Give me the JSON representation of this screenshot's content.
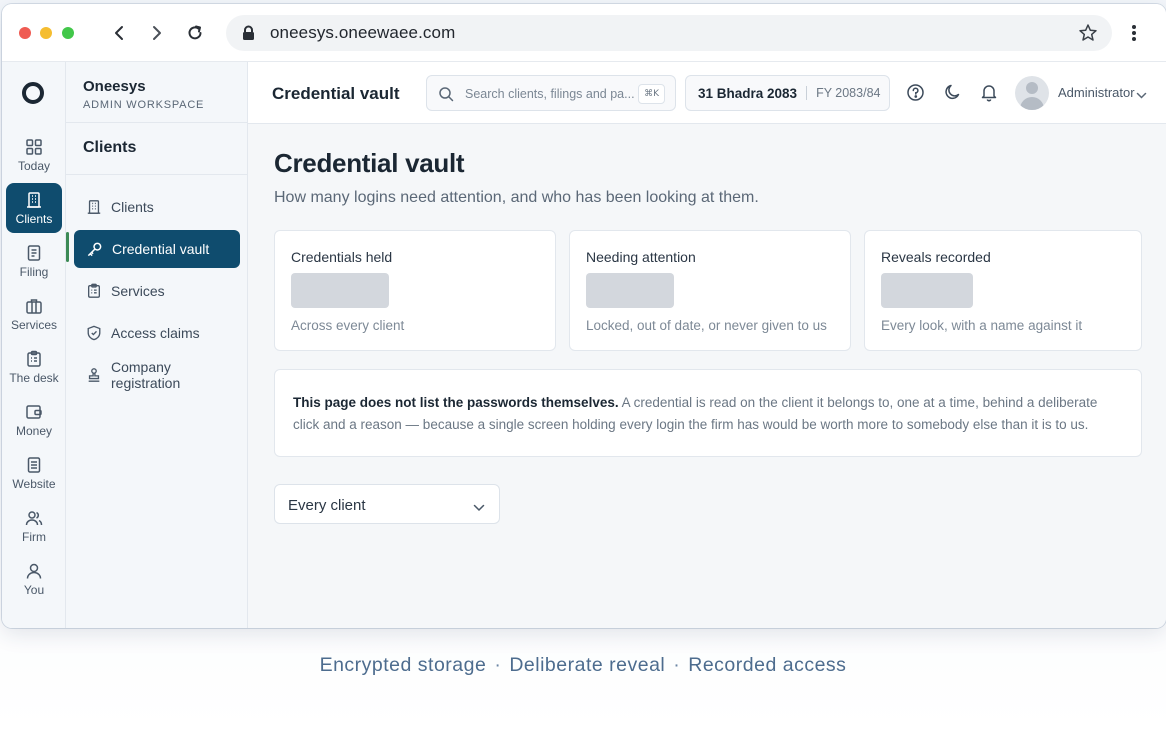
{
  "browser": {
    "url": "oneesys.oneewaee.com"
  },
  "rail": {
    "items": [
      {
        "label": "Today",
        "icon": "grid-icon"
      },
      {
        "label": "Clients",
        "icon": "building-icon"
      },
      {
        "label": "Filing",
        "icon": "document-icon"
      },
      {
        "label": "Services",
        "icon": "briefcase-icon"
      },
      {
        "label": "The desk",
        "icon": "clipboard-icon"
      },
      {
        "label": "Money",
        "icon": "wallet-icon"
      },
      {
        "label": "Website",
        "icon": "page-icon"
      },
      {
        "label": "Firm",
        "icon": "users-icon"
      },
      {
        "label": "You",
        "icon": "user-icon"
      }
    ],
    "active": "Clients"
  },
  "sidebar": {
    "brand_name": "Oneesys",
    "brand_sub": "ADMIN WORKSPACE",
    "section": "Clients",
    "items": [
      {
        "label": "Clients",
        "icon": "building-icon"
      },
      {
        "label": "Credential vault",
        "icon": "key-icon"
      },
      {
        "label": "Services",
        "icon": "clipboard-icon"
      },
      {
        "label": "Access claims",
        "icon": "shield-icon"
      },
      {
        "label": "Company registration",
        "icon": "stamp-icon"
      }
    ],
    "active": "Credential vault"
  },
  "topbar": {
    "title": "Credential vault",
    "search_placeholder": "Search clients, filings and pa...",
    "shortcut": "⌘K",
    "date": "31 Bhadra 2083",
    "fiscal_year": "FY 2083/84",
    "user": "Administrator"
  },
  "page": {
    "heading": "Credential vault",
    "lead": "How many logins need attention, and who has been looking at them.",
    "cards": [
      {
        "label": "Credentials held",
        "foot": "Across every client"
      },
      {
        "label": "Needing attention",
        "foot": "Locked, out of date, or never given to us"
      },
      {
        "label": "Reveals recorded",
        "foot": "Every look, with a name against it"
      }
    ],
    "notice_bold": "This page does not list the passwords themselves.",
    "notice_text": " A credential is read on the client it belongs to, one at a time, behind a deliberate click and a reason — because a single screen holding every login the firm has would be worth more to somebody else than it is to us.",
    "filter_value": "Every client"
  },
  "tagline": [
    "Encrypted storage",
    "Deliberate reveal",
    "Recorded access"
  ],
  "colors": {
    "accent": "#0f4c6e",
    "marker": "#3c8a55"
  }
}
